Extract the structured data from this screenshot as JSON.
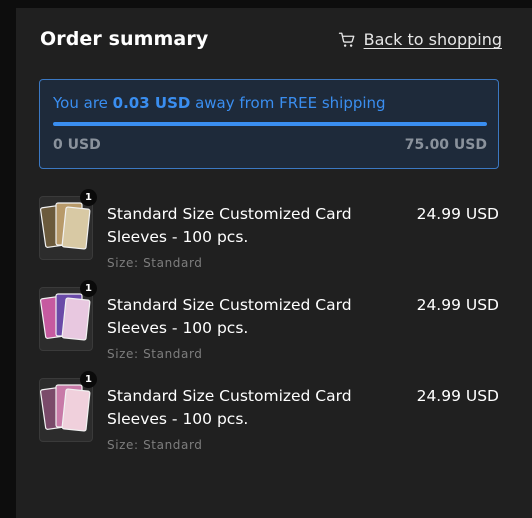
{
  "header": {
    "title": "Order summary",
    "back_link_label": "Back to shopping",
    "cart_icon": "cart-icon"
  },
  "shipping": {
    "message_prefix": "You are ",
    "amount_away": "0.03 USD",
    "message_suffix": " away from FREE shipping",
    "progress_fraction": 0.9996,
    "range_min": "0 USD",
    "range_max": "75.00 USD",
    "accent_color": "#3a8ef0"
  },
  "items": [
    {
      "name": "Standard Size Customized Card Sleeves - 100 pcs.",
      "price": "24.99 USD",
      "variant": "Size: Standard",
      "quantity": "1",
      "palette": [
        "#b89a6a",
        "#6b5a3c",
        "#d8c9a4"
      ]
    },
    {
      "name": "Standard Size Customized Card Sleeves - 100 pcs.",
      "price": "24.99 USD",
      "variant": "Size: Standard",
      "quantity": "1",
      "palette": [
        "#6a4aa8",
        "#c65aa0",
        "#e8c8e0"
      ]
    },
    {
      "name": "Standard Size Customized Card Sleeves - 100 pcs.",
      "price": "24.99 USD",
      "variant": "Size: Standard",
      "quantity": "1",
      "palette": [
        "#c87aa8",
        "#7a4a6a",
        "#f0d0dc"
      ]
    }
  ]
}
